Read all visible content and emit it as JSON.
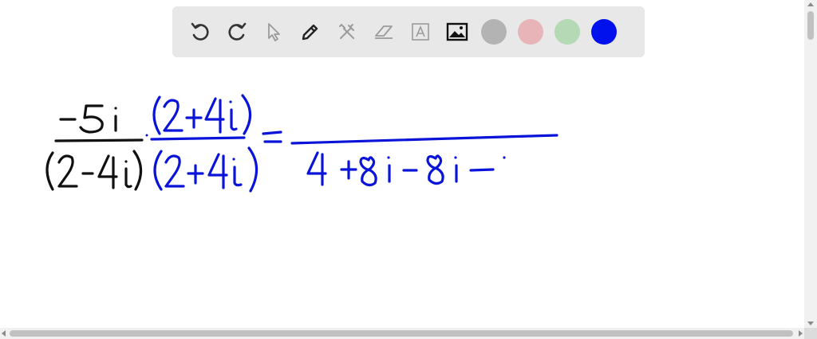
{
  "toolbar": {
    "tools": [
      {
        "name": "undo-icon",
        "enabled": true
      },
      {
        "name": "redo-icon",
        "enabled": true
      },
      {
        "name": "select-pointer-icon",
        "enabled": false
      },
      {
        "name": "pen-icon",
        "enabled": true
      },
      {
        "name": "tools-icon",
        "enabled": false
      },
      {
        "name": "eraser-icon",
        "enabled": false
      },
      {
        "name": "text-box-icon",
        "enabled": false
      },
      {
        "name": "image-icon",
        "enabled": true
      }
    ],
    "colors": [
      {
        "name": "gray",
        "hex": "#b3b3b3",
        "selected": false
      },
      {
        "name": "pink",
        "hex": "#e8b4b8",
        "selected": false
      },
      {
        "name": "light-green",
        "hex": "#b4d9b4",
        "selected": false
      },
      {
        "name": "blue",
        "hex": "#0011ee",
        "selected": true
      }
    ]
  },
  "whiteboard": {
    "ink_colors": {
      "black": "#111111",
      "blue": "#0a14d8"
    },
    "handwriting_description_strings": []
  }
}
